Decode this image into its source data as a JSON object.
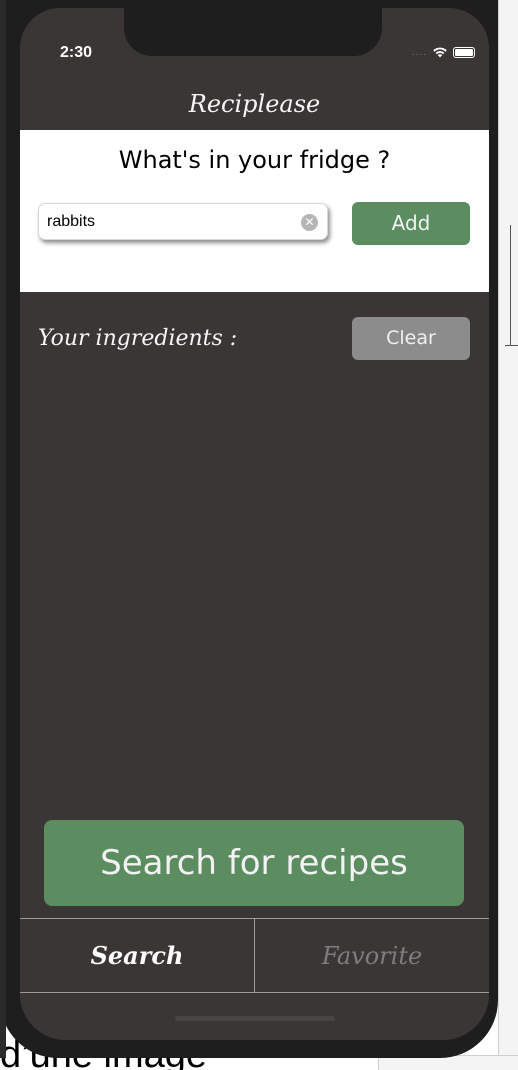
{
  "status_bar": {
    "time": "2:30",
    "signal_dots": "....",
    "wifi_icon": "wifi-icon",
    "battery_icon": "battery-icon"
  },
  "nav": {
    "title": "Reciplease"
  },
  "fridge": {
    "title": "What's in your fridge ?",
    "search_value": "rabbits",
    "clear_icon": "close-circle-icon",
    "add_label": "Add"
  },
  "ingredients": {
    "label": "Your ingredients :",
    "clear_label": "Clear",
    "items": []
  },
  "search_button": {
    "label": "Search for recipes"
  },
  "tabs": [
    {
      "label": "Search",
      "selected": true
    },
    {
      "label": "Favorite",
      "selected": false
    }
  ],
  "background": {
    "caption_fragment": "d’une image"
  },
  "colors": {
    "accent_green": "#5b8d61",
    "screen_bg": "#3b3636",
    "clear_gray": "#8c8c8c"
  }
}
